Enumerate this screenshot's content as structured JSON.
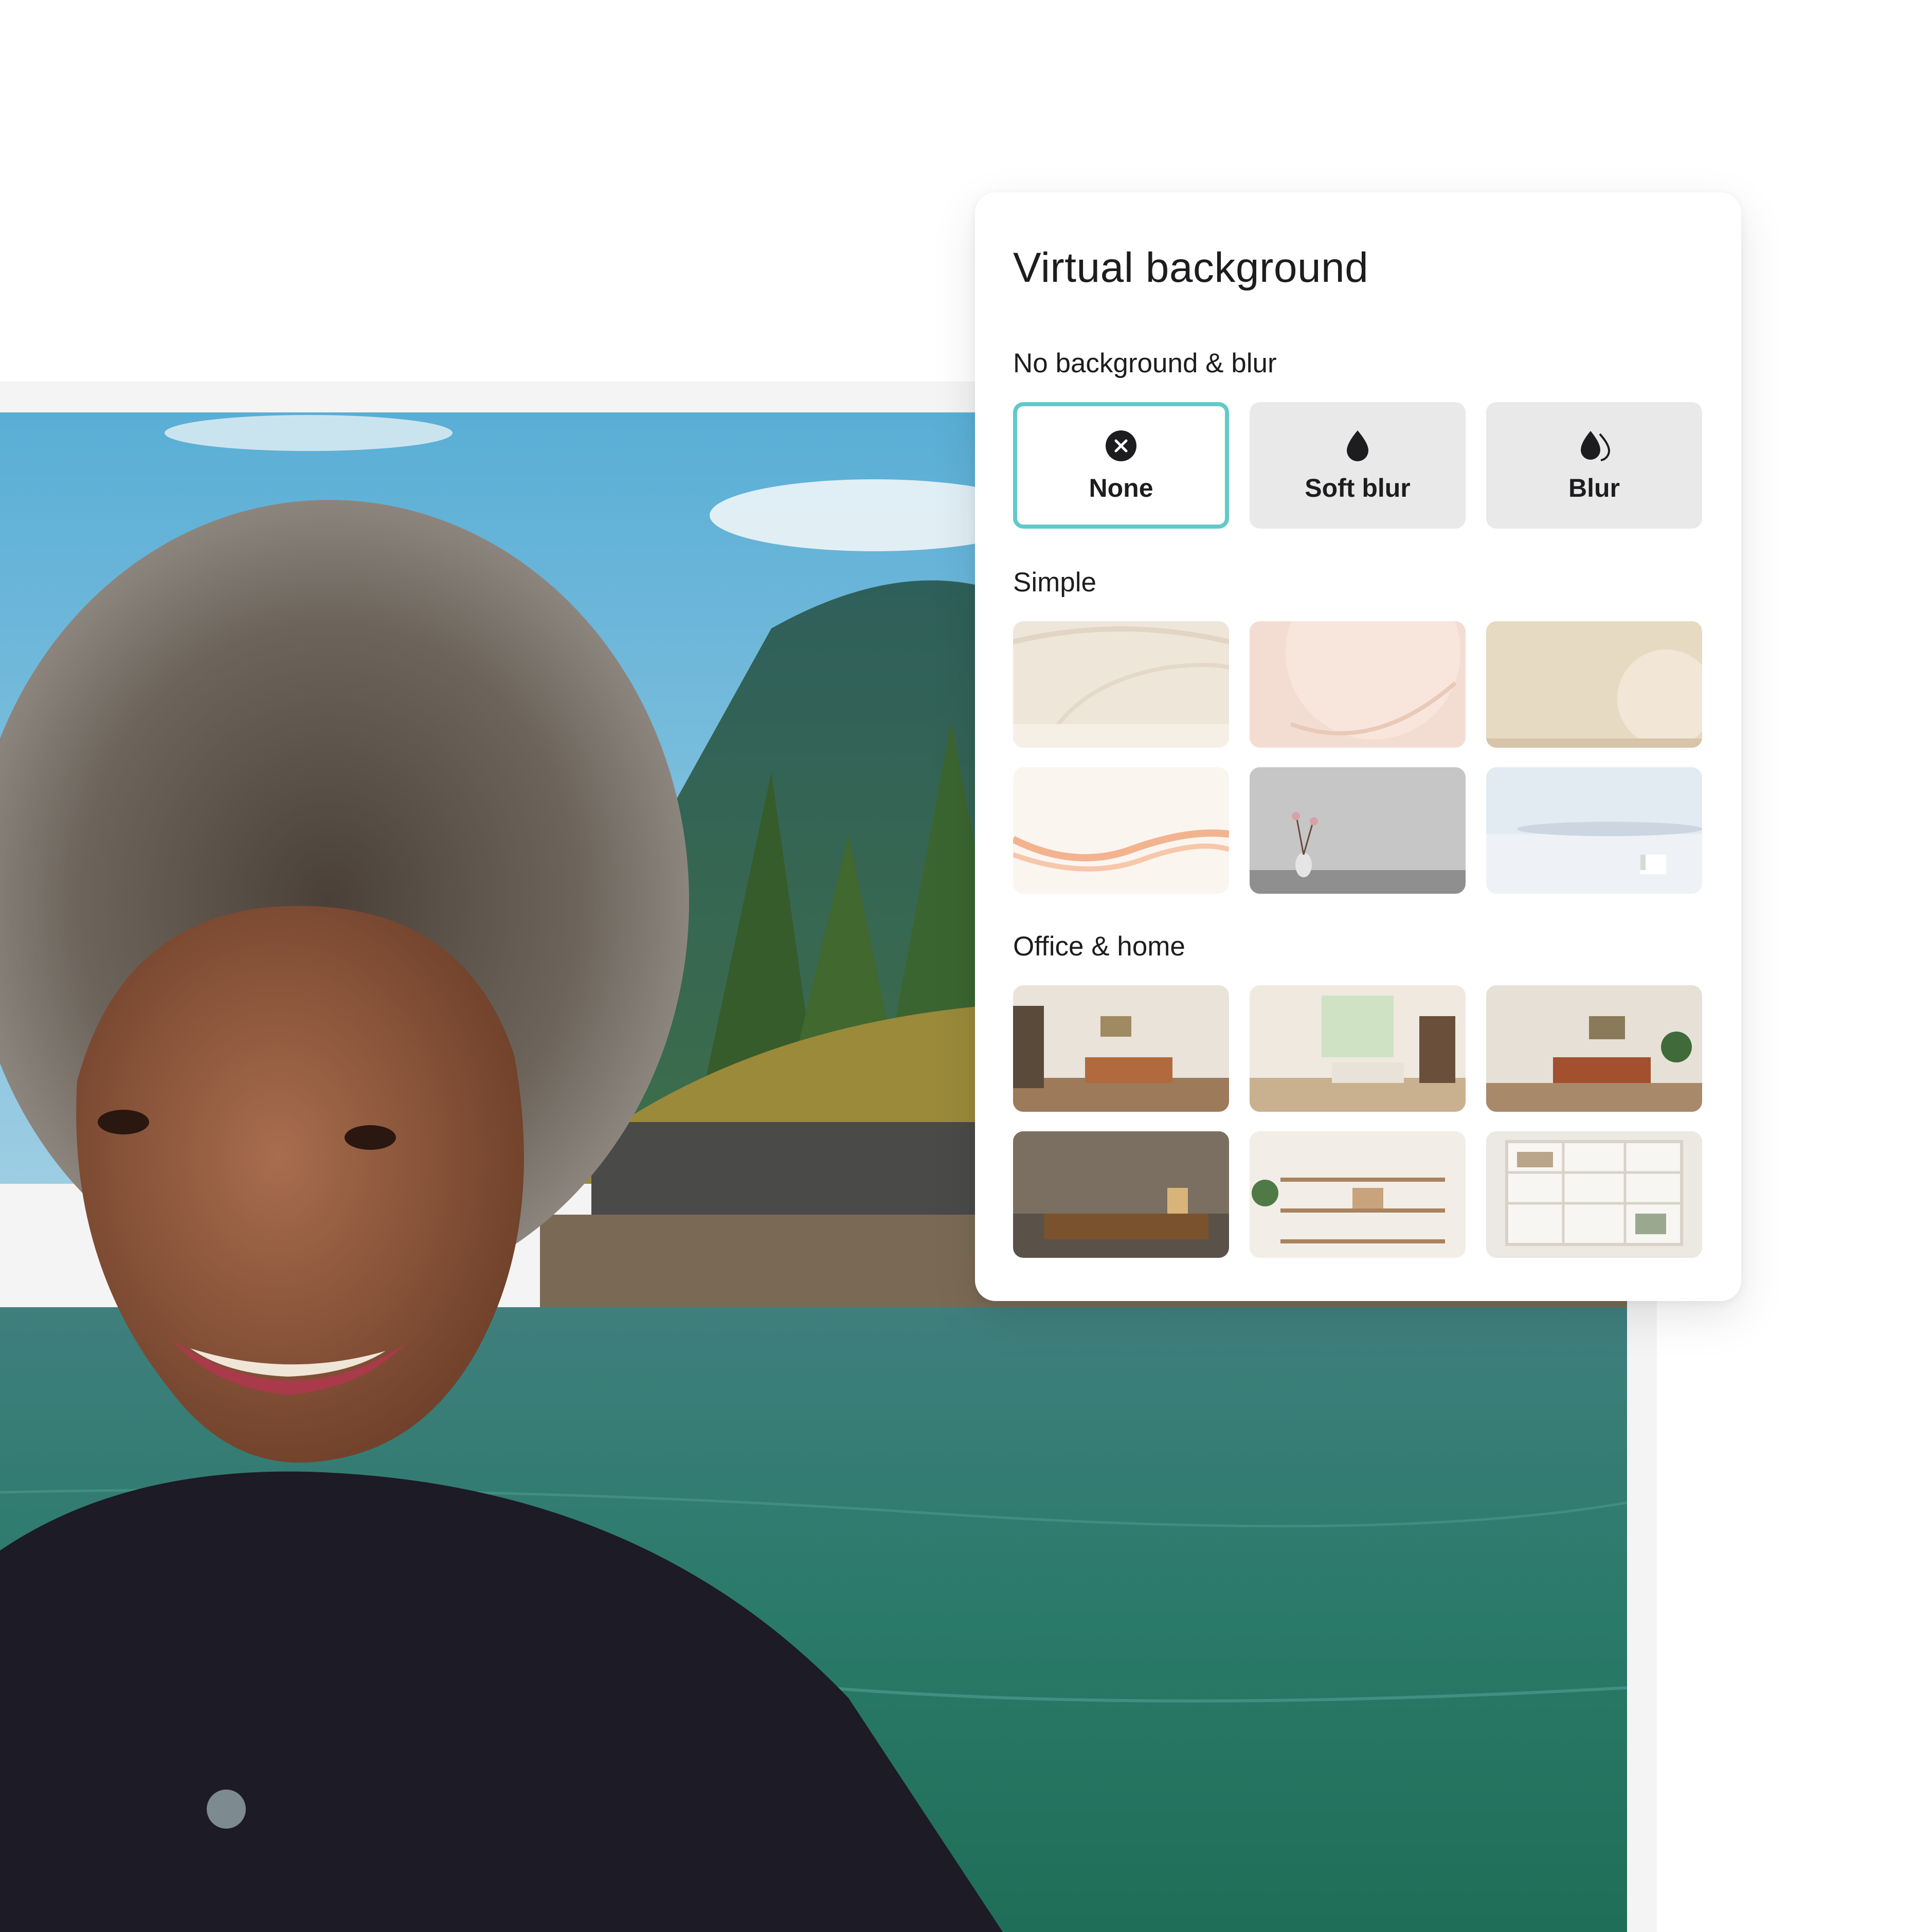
{
  "panel": {
    "title": "Virtual background",
    "sections": {
      "effects": {
        "label": "No background & blur",
        "options": [
          {
            "label": "None",
            "icon": "close-circle-icon",
            "selected": true
          },
          {
            "label": "Soft blur",
            "icon": "drop-icon",
            "selected": false
          },
          {
            "label": "Blur",
            "icon": "double-drop-icon",
            "selected": false
          }
        ]
      },
      "simple": {
        "label": "Simple",
        "thumbnails": [
          "cream-curves",
          "peach-sphere",
          "beige-half-circle",
          "orange-waves",
          "grey-room-vase",
          "misty-horizon-chair"
        ]
      },
      "office_home": {
        "label": "Office & home",
        "thumbnails": [
          "living-room-tan-sofa",
          "sunroom-lounge",
          "living-room-brown-sofa",
          "dark-study-desk",
          "wall-shelves",
          "white-bookcase"
        ]
      }
    }
  },
  "colors": {
    "accent": "#62c9c8",
    "option_bg": "#e9e9e9",
    "text": "#1d1d1f"
  }
}
